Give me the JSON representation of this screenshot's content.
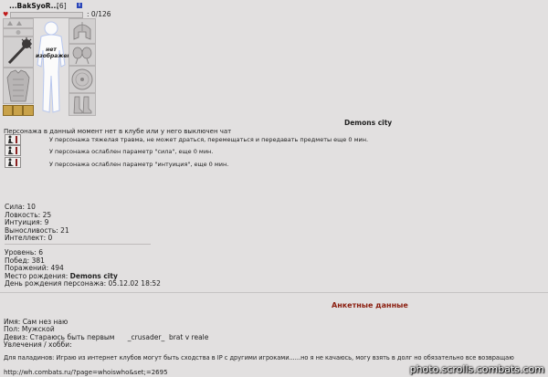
{
  "header": {
    "nickname": "...BakSyoR...",
    "level": "[6]",
    "info_icon": "i",
    "hp_text": ": 0/126",
    "hp_fraction": 0
  },
  "avatar": {
    "no_image_label": "нет изображения"
  },
  "city": "Demons city",
  "status_line": "Персонажа в данный момент нет в клубе или у него выключен чат",
  "effects": [
    "У персонажа тяжелая травма, не может драться, перемещаться и передавать предметы еще 0 мин.",
    "У персонажа ослаблен параметр \"сила\", еще 0 мин.",
    "У персонажа ослаблен параметр \"интуиция\", еще 0 мин."
  ],
  "stats": [
    "Сила: 10",
    "Ловкость: 25",
    "Интуиция: 9",
    "Выносливость: 21",
    "Интеллект: 0"
  ],
  "record": {
    "level": "Уровень: 6",
    "wins": "Побед: 381",
    "losses": "Поражений: 494",
    "birthplace_label": "Место рождения: ",
    "birthplace": "Demons city",
    "birthday": "День рождения персонажа: 05.12.02 18:52"
  },
  "profile": {
    "section_title": "Анкетные данные",
    "name": "Имя: Сам нез наю",
    "gender": "Пол: Мужской",
    "motto": "Девиз: Стараюсь быть первым      _crusader_  brat v reale",
    "hobbies": "Увлечения / хобби:",
    "paladins": "Для паладинов: Играю из интернет клубов могут быть сходства в IP с другими игроками......но я не качаюсь, могу взять в долг но обязательно все возвращаю"
  },
  "url": "http://wh.combats.ru/?page=whoiswho&set;=2695",
  "watermark": "photo.scrolls.combats.com",
  "colors": {
    "background": "#e2e0e0",
    "section_title": "#8b1e0f",
    "heart": "#c01818",
    "info_icon": "#2b46b8"
  },
  "icons": {
    "heart": "heart-icon",
    "info": "info-icon",
    "effect": "injury-icon"
  }
}
